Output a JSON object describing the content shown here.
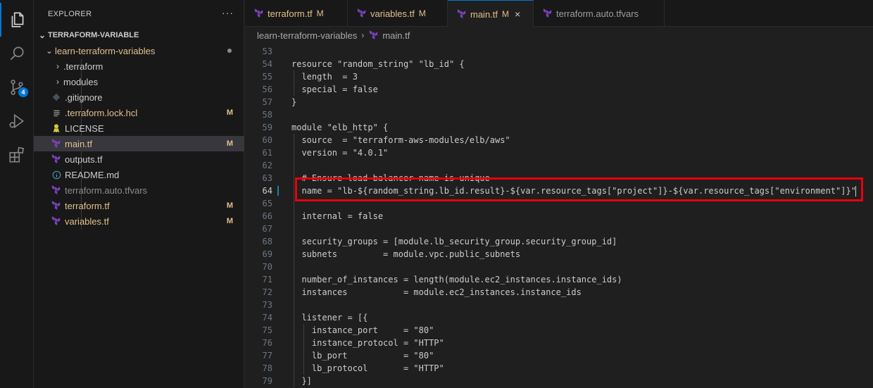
{
  "explorer": {
    "title": "EXPLORER",
    "more": "···",
    "root_folder": "TERRAFORM-VARIABLE",
    "folder": "learn-terraform-variables",
    "items": [
      {
        "label": ".terraform",
        "type": "folder",
        "status": ""
      },
      {
        "label": "modules",
        "type": "folder",
        "status": ""
      },
      {
        "label": ".gitignore",
        "type": "git",
        "status": ""
      },
      {
        "label": ".terraform.lock.hcl",
        "type": "lines",
        "status": "M"
      },
      {
        "label": "LICENSE",
        "type": "license",
        "status": ""
      },
      {
        "label": "main.tf",
        "type": "terraform",
        "status": "M"
      },
      {
        "label": "outputs.tf",
        "type": "terraform",
        "status": ""
      },
      {
        "label": "README.md",
        "type": "info",
        "status": ""
      },
      {
        "label": "terraform.auto.tfvars",
        "type": "terraform",
        "status": ""
      },
      {
        "label": "terraform.tf",
        "type": "terraform",
        "status": "M"
      },
      {
        "label": "variables.tf",
        "type": "terraform",
        "status": "M"
      }
    ]
  },
  "activity": {
    "scm_badge": "4"
  },
  "tabs": [
    {
      "label": "terraform.tf",
      "status": "M"
    },
    {
      "label": "variables.tf",
      "status": "M"
    },
    {
      "label": "main.tf",
      "status": "M",
      "close": "×"
    },
    {
      "label": "terraform.auto.tfvars",
      "status": ""
    }
  ],
  "breadcrumb": {
    "folder": "learn-terraform-variables",
    "separator": "›",
    "file": "main.tf"
  },
  "editor": {
    "current_line": 64,
    "lines": [
      {
        "n": "53",
        "text": ""
      },
      {
        "n": "54",
        "text": "resource \"random_string\" \"lb_id\" {"
      },
      {
        "n": "55",
        "text": "  length  = 3"
      },
      {
        "n": "56",
        "text": "  special = false"
      },
      {
        "n": "57",
        "text": "}"
      },
      {
        "n": "58",
        "text": ""
      },
      {
        "n": "59",
        "text": "module \"elb_http\" {"
      },
      {
        "n": "60",
        "text": "  source  = \"terraform-aws-modules/elb/aws\""
      },
      {
        "n": "61",
        "text": "  version = \"4.0.1\""
      },
      {
        "n": "62",
        "text": ""
      },
      {
        "n": "63",
        "text": "  # Ensure load balancer name is unique"
      },
      {
        "n": "64",
        "text": "  name = \"lb-${random_string.lb_id.result}-${var.resource_tags[\"project\"]}-${var.resource_tags[\"environment\"]}\""
      },
      {
        "n": "65",
        "text": ""
      },
      {
        "n": "66",
        "text": "  internal = false"
      },
      {
        "n": "67",
        "text": ""
      },
      {
        "n": "68",
        "text": "  security_groups = [module.lb_security_group.security_group_id]"
      },
      {
        "n": "69",
        "text": "  subnets         = module.vpc.public_subnets"
      },
      {
        "n": "70",
        "text": ""
      },
      {
        "n": "71",
        "text": "  number_of_instances = length(module.ec2_instances.instance_ids)"
      },
      {
        "n": "72",
        "text": "  instances           = module.ec2_instances.instance_ids"
      },
      {
        "n": "73",
        "text": ""
      },
      {
        "n": "74",
        "text": "  listener = [{"
      },
      {
        "n": "75",
        "text": "    instance_port     = \"80\""
      },
      {
        "n": "76",
        "text": "    instance_protocol = \"HTTP\""
      },
      {
        "n": "77",
        "text": "    lb_port           = \"80\""
      },
      {
        "n": "78",
        "text": "    lb_protocol       = \"HTTP\""
      },
      {
        "n": "79",
        "text": "  }]"
      }
    ]
  },
  "colors": {
    "terraform_icon": "#7b42bc",
    "modified": "#e2c08d",
    "accent": "#0078d4",
    "highlight": "#e8000c"
  }
}
